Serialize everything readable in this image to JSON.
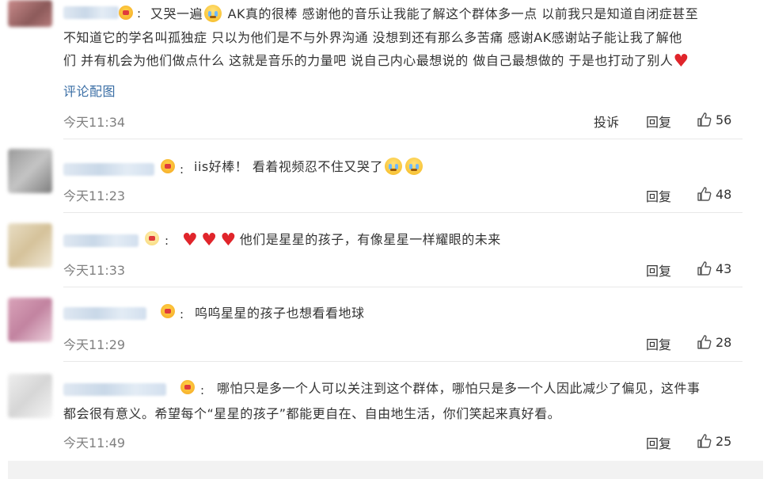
{
  "comments": [
    {
      "text_lines": [
        "又哭一遍",
        "AK真的很棒 感谢他的音乐让我能了解这个群体多一点 以前我只是知道自闭症甚至",
        "不知道它的学名叫孤独症 只以为他们是不与外界沟通 没想到还有那么多苦痛 感谢AK感谢站子能让我了解他",
        "们 并有机会为他们做点什么 这就是音乐的力量吧 说自己内心最想说的 做自己最想做的 于是也打动了别人"
      ],
      "link": "评论配图",
      "time": "今天11:34",
      "report": "投诉",
      "reply": "回复",
      "likes": "56"
    },
    {
      "text": "iis好棒！  看着视频忍不住又哭了",
      "time": "今天11:23",
      "reply": "回复",
      "likes": "48"
    },
    {
      "text": "他们是星星的孩子，有像星星一样耀眼的未来",
      "time": "今天11:33",
      "reply": "回复",
      "likes": "43"
    },
    {
      "text": "呜呜星星的孩子也想看看地球",
      "time": "今天11:29",
      "reply": "回复",
      "likes": "28"
    },
    {
      "text_lines": [
        "哪怕只是多一个人可以关注到这个群体，哪怕只是多一个人因此减少了偏见，这件事",
        "都会很有意义。希望每个“星星的孩子”都能更自在、自由地生活，你们笑起来真好看。"
      ],
      "time": "今天11:49",
      "reply": "回复",
      "likes": "25"
    }
  ],
  "colon": ":"
}
